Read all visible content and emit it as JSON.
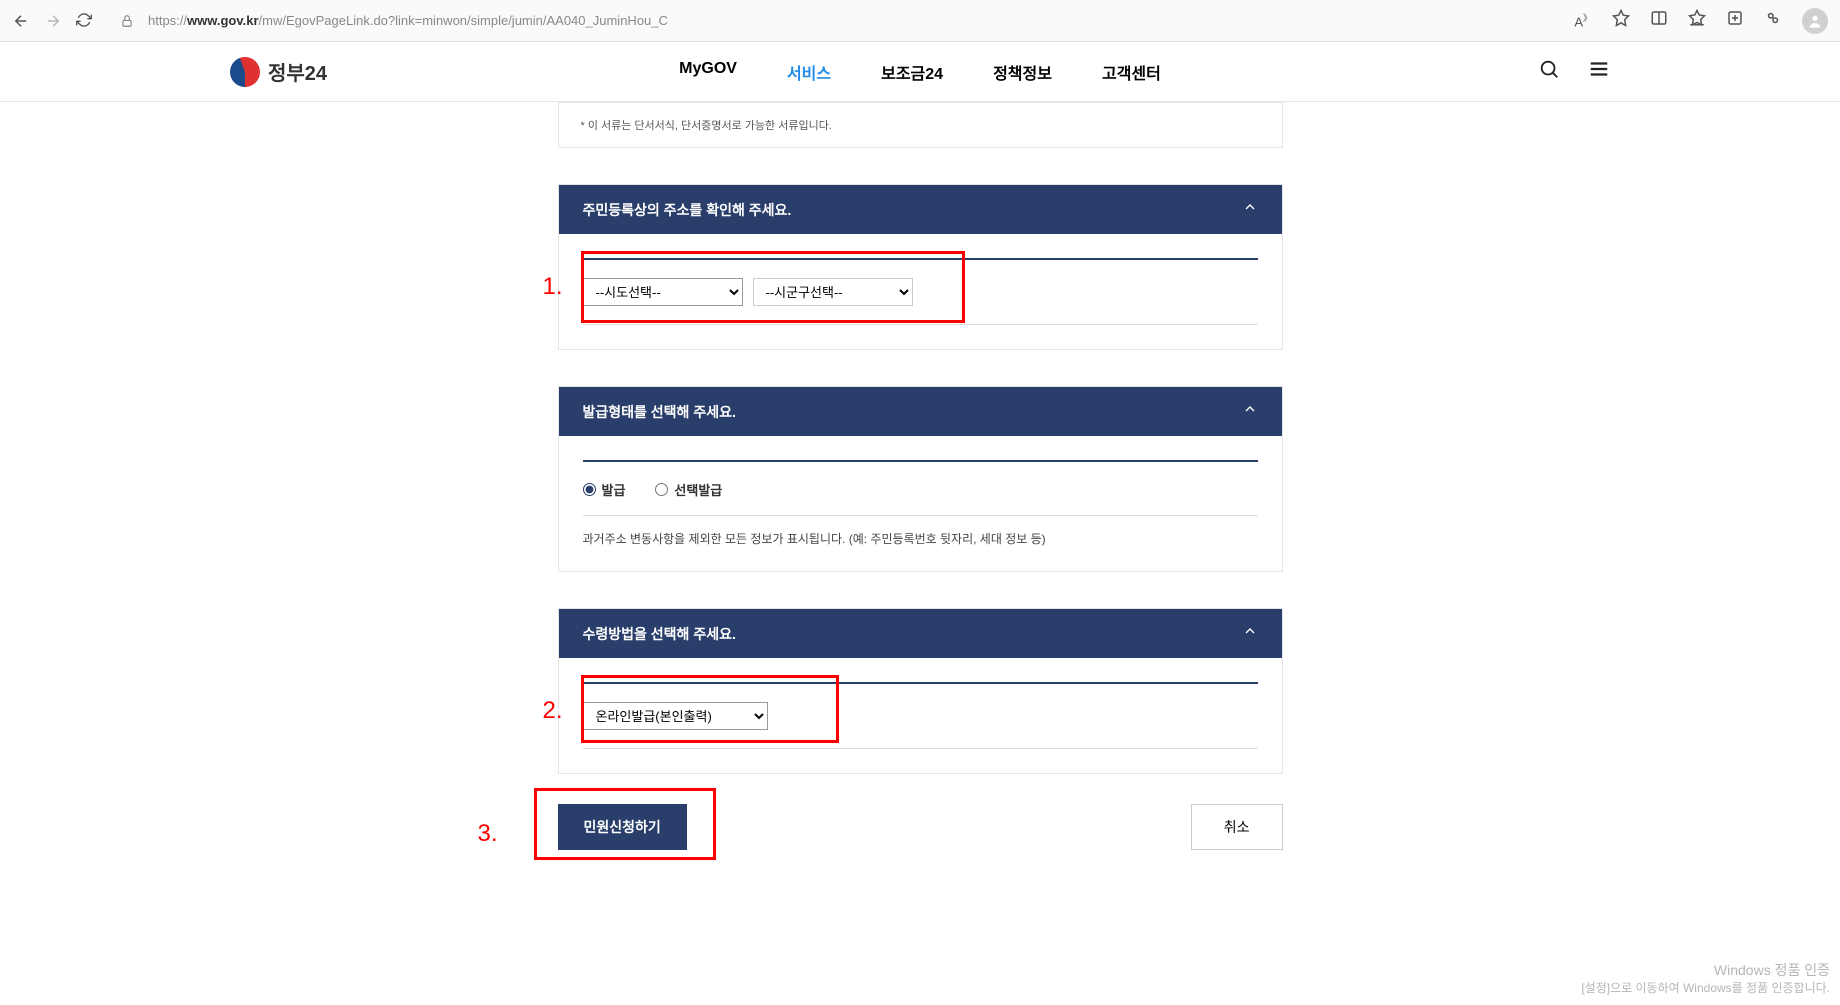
{
  "browser": {
    "url_host": "www.gov.kr",
    "url_prefix": "https://",
    "url_path": "/mw/EgovPageLink.do?link=minwon/simple/jumin/AA040_JuminHou_C"
  },
  "site": {
    "logo": "정부24",
    "nav": [
      "MyGOV",
      "서비스",
      "보조금24",
      "정책정보",
      "고객센터"
    ],
    "active_nav_index": 1
  },
  "note": "* 이 서류는 단서서식, 단서증명서로 가능한 서류입니다.",
  "panels": {
    "address": {
      "title": "주민등록상의 주소를 확인해 주세요.",
      "sido": "--시도선택--",
      "sigungu": "--시군구선택--"
    },
    "issue_type": {
      "title": "발급형태를 선택해 주세요.",
      "radio1": "발급",
      "radio2": "선택발급",
      "desc": "과거주소 변동사항을 제외한 모든 정보가 표시됩니다. (예: 주민등록번호 뒷자리, 세대 정보 등)"
    },
    "receipt": {
      "title": "수령방법을 선택해 주세요.",
      "method": "온라인발급(본인출력)"
    }
  },
  "buttons": {
    "submit": "민원신청하기",
    "cancel": "취소"
  },
  "annotations": {
    "a1": "1.",
    "a2": "2.",
    "a3": "3."
  },
  "watermark": {
    "line1": "Windows 정품 인증",
    "line2": "[설정]으로 이동하여 Windows를 정품 인증합니다."
  }
}
